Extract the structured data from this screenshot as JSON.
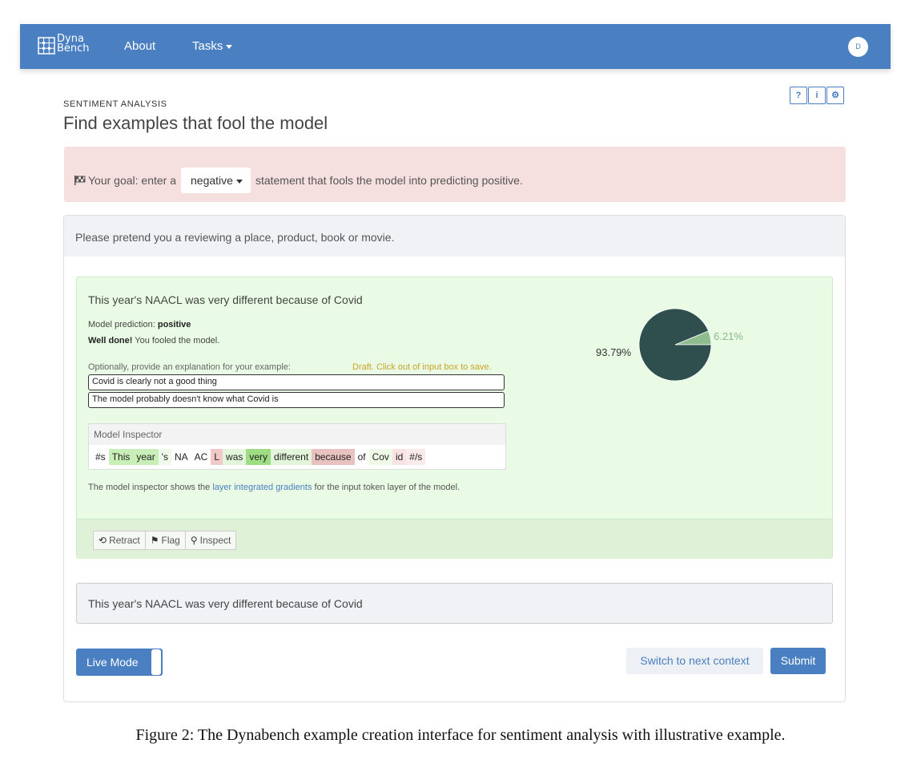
{
  "app": {
    "logo_line1": "Dyna",
    "logo_line2": "Bench"
  },
  "nav": {
    "about": "About",
    "tasks": "Tasks",
    "avatar_initial": "D"
  },
  "toolbar": {
    "help": "?",
    "info": "i",
    "settings": "⚙"
  },
  "task": {
    "label": "SENTIMENT ANALYSIS",
    "title": "Find examples that fool the model"
  },
  "goal": {
    "prefix": "Your goal: enter a",
    "selected": "negative",
    "suffix": "statement that fools the model into predicting positive."
  },
  "context_card": {
    "header": "Please pretend you a reviewing a place, product, book or movie."
  },
  "result": {
    "text": "This year's NAACL was very different because of Covid",
    "prediction_label": "Model prediction:",
    "prediction_value": "positive",
    "well_done": "Well done!",
    "fooled": "You fooled the model.",
    "explanation_label": "Optionally, provide an explanation for your example:",
    "draft_note": "Draft. Click out of input box to save.",
    "explanation_1": "Covid is clearly not a good thing",
    "explanation_2": "The model probably doesn't know what Covid is",
    "inspector_title": "Model Inspector",
    "tokens": [
      {
        "t": "#s",
        "c": "#ffffff"
      },
      {
        "t": "This",
        "c": "#c9efb8"
      },
      {
        "t": "year",
        "c": "#c9efb8"
      },
      {
        "t": "'s",
        "c": "#f0faeb"
      },
      {
        "t": "NA",
        "c": "#ffffff"
      },
      {
        "t": "AC",
        "c": "#ffffff"
      },
      {
        "t": "L",
        "c": "#f2c9c9"
      },
      {
        "t": "was",
        "c": "#e3f5da"
      },
      {
        "t": "very",
        "c": "#9edd84"
      },
      {
        "t": "different",
        "c": "#e3f5da"
      },
      {
        "t": "because",
        "c": "#e9c1c1"
      },
      {
        "t": "of",
        "c": "#ffffff"
      },
      {
        "t": "Cov",
        "c": "#eef9e8"
      },
      {
        "t": "id",
        "c": "#f8e3e3"
      },
      {
        "t": "#/s",
        "c": "#fbeaea"
      }
    ],
    "note_prefix": "The model inspector shows the",
    "note_link": "layer integrated gradients",
    "note_suffix": "for the input token layer of the model.",
    "buttons": {
      "retract": "Retract",
      "flag": "Flag",
      "inspect": "Inspect"
    }
  },
  "chart_data": {
    "type": "pie",
    "slices": [
      {
        "label": "93.79%",
        "value": 93.79,
        "color": "#2f4f4f"
      },
      {
        "label": "6.21%",
        "value": 6.21,
        "color": "#8fbc8f"
      }
    ]
  },
  "context": {
    "text": "This year's NAACL was very different because of Covid"
  },
  "footer": {
    "live_mode": "Live Mode",
    "switch": "Switch to next context",
    "submit": "Submit"
  },
  "caption": "Figure 2: The Dynabench example creation interface for sentiment analysis with illustrative example."
}
